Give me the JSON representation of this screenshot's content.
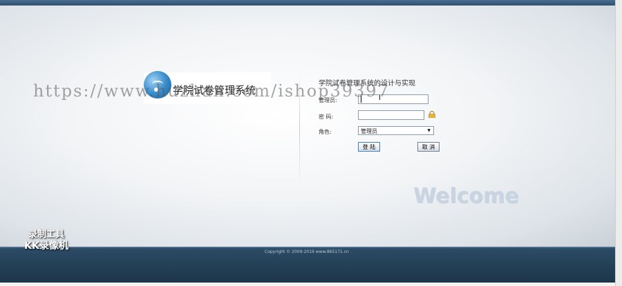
{
  "app": {
    "logo_title": "学院试卷管理系统"
  },
  "login_form": {
    "title": "学院试卷管理系统的设计与实现",
    "username_label": "管理员:",
    "username_value": "",
    "password_label": "密 码:",
    "password_value": "",
    "role_label": "角色:",
    "role_selected": "管理员",
    "login_button": "登 陆",
    "cancel_button": "取 消"
  },
  "welcome_text": "Welcome",
  "footer": {
    "copyright": "Copyright © 2009-2019 www.865171.cn"
  },
  "overlays": {
    "watermark_url": "https://www.huzhan.com/ishop39397",
    "recorder_line1": "录制工具",
    "recorder_line2": "KK录像机"
  },
  "icons": {
    "lock": "lock-icon",
    "logo": "logo-ball-icon"
  },
  "colors": {
    "topbar": "#3b5d7e",
    "footer": "#233f55",
    "login_border": "#3b7dbf"
  }
}
